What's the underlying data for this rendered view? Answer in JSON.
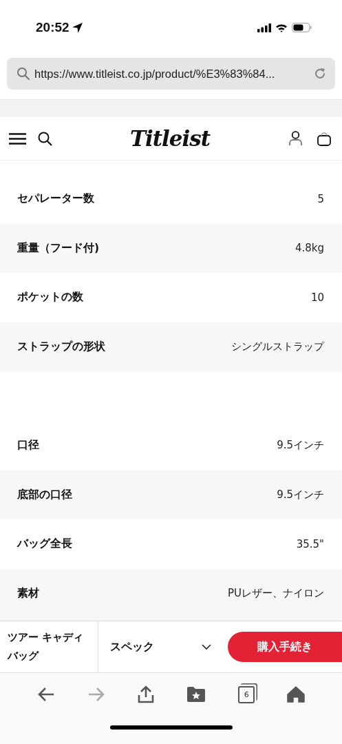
{
  "status_bar": {
    "time": "20:52"
  },
  "url_bar": {
    "url": "https://www.titleist.co.jp/product/%E3%83%84..."
  },
  "header": {
    "logo": "Titleist"
  },
  "spec_groups": [
    {
      "rows": [
        {
          "label": "セパレーター数",
          "value": "5"
        },
        {
          "label": "重量（フード付)",
          "value": "4.8kg"
        },
        {
          "label": "ポケットの数",
          "value": "10"
        },
        {
          "label": "ストラップの形状",
          "value": "シングルストラップ"
        }
      ]
    },
    {
      "rows": [
        {
          "label": "口径",
          "value": "9.5インチ"
        },
        {
          "label": "底部の口径",
          "value": "9.5インチ"
        },
        {
          "label": "バッグ全長",
          "value": "35.5\""
        },
        {
          "label": "素材",
          "value": "PUレザー、ナイロン"
        }
      ]
    }
  ],
  "sticky_bar": {
    "product": "ツアー キャディバッグ",
    "section": "スペック",
    "buy": "購入手続き"
  },
  "toolbar": {
    "back_disabled": false,
    "forward_disabled": true,
    "tab_count": "6"
  }
}
